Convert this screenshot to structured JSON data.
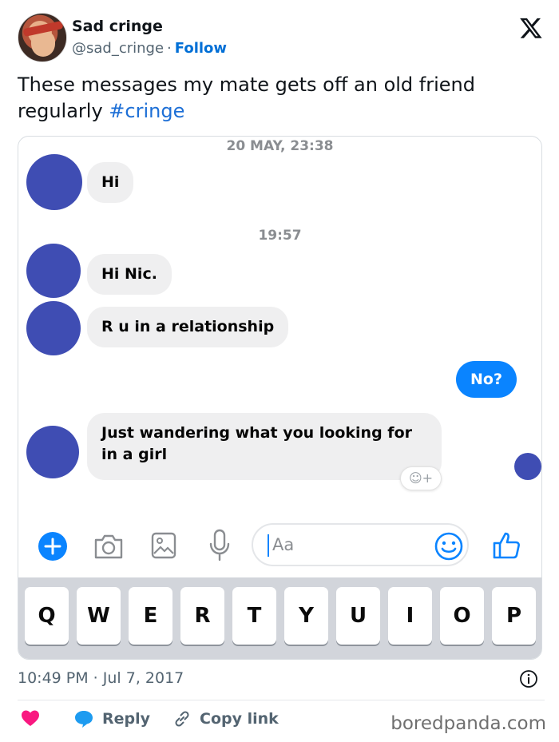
{
  "author": {
    "name": "Sad cringe",
    "handle": "@sad_cringe",
    "separator": "·",
    "follow_label": "Follow"
  },
  "tweet": {
    "text": "These messages my mate gets off an old friend regularly ",
    "hashtag": "#cringe",
    "timestamp": "10:49 PM · Jul 7, 2017"
  },
  "chat": {
    "timestamp_1": "20 MAY, 23:38",
    "timestamp_2": "19:57",
    "messages": [
      {
        "from": "them",
        "text": "Hi"
      },
      {
        "from": "them",
        "text": "Hi Nic."
      },
      {
        "from": "them",
        "text": "R u in a relationship"
      },
      {
        "from": "me",
        "text": "No?"
      },
      {
        "from": "them",
        "text": "Just wandering what you looking for in a girl"
      }
    ],
    "react_label": "☺+",
    "composer_placeholder": "Aa",
    "keyboard_row": [
      "Q",
      "W",
      "E",
      "R",
      "T",
      "Y",
      "U",
      "I",
      "O",
      "P"
    ],
    "colors": {
      "avatar": "#3f4db3",
      "my_bubble": "#0a84ff",
      "icons": "#0a84ff"
    }
  },
  "actions": {
    "reply_label": "Reply",
    "copy_link_label": "Copy link"
  },
  "watermark": "boredpanda.com",
  "colors": {
    "link": "#006fd6",
    "like": "#f91880",
    "reply": "#1d9bf0"
  }
}
